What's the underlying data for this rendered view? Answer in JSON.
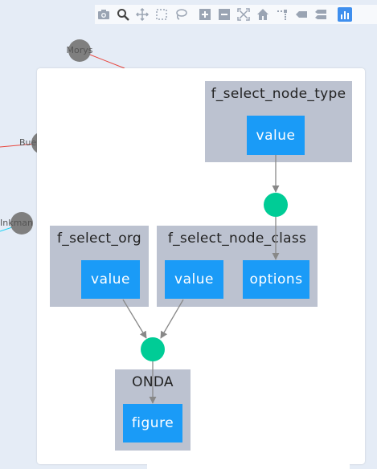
{
  "background_graph": {
    "nodes": [
      {
        "label": "Morys"
      },
      {
        "label": "Bue"
      },
      {
        "label": "Inkman"
      }
    ]
  },
  "modebar": {
    "buttons": [
      {
        "icon": "camera-icon"
      },
      {
        "icon": "zoom-icon"
      },
      {
        "icon": "pan-icon"
      },
      {
        "icon": "box-select-icon"
      },
      {
        "icon": "lasso-select-icon"
      },
      {
        "icon": "zoom-in-icon"
      },
      {
        "icon": "zoom-out-icon"
      },
      {
        "icon": "autoscale-icon"
      },
      {
        "icon": "reset-axes-icon"
      },
      {
        "icon": "spike-lines-icon"
      },
      {
        "icon": "hover-closest-icon"
      },
      {
        "icon": "hover-compare-icon"
      },
      {
        "icon": "plotly-logo-icon"
      }
    ]
  },
  "dag": {
    "clusters": {
      "node_type": {
        "title": "f_select_node_type",
        "props": [
          "value"
        ]
      },
      "org": {
        "title": "f_select_org",
        "props": [
          "value"
        ]
      },
      "node_class": {
        "title": "f_select_node_class",
        "props": [
          "value",
          "options"
        ]
      },
      "onda": {
        "title": "ONDA",
        "props": [
          "figure"
        ]
      }
    },
    "colors": {
      "cluster": "#bcc2d0",
      "prop": "#1a9bf7",
      "callback": "#00cc96",
      "edge": "#888888"
    }
  }
}
